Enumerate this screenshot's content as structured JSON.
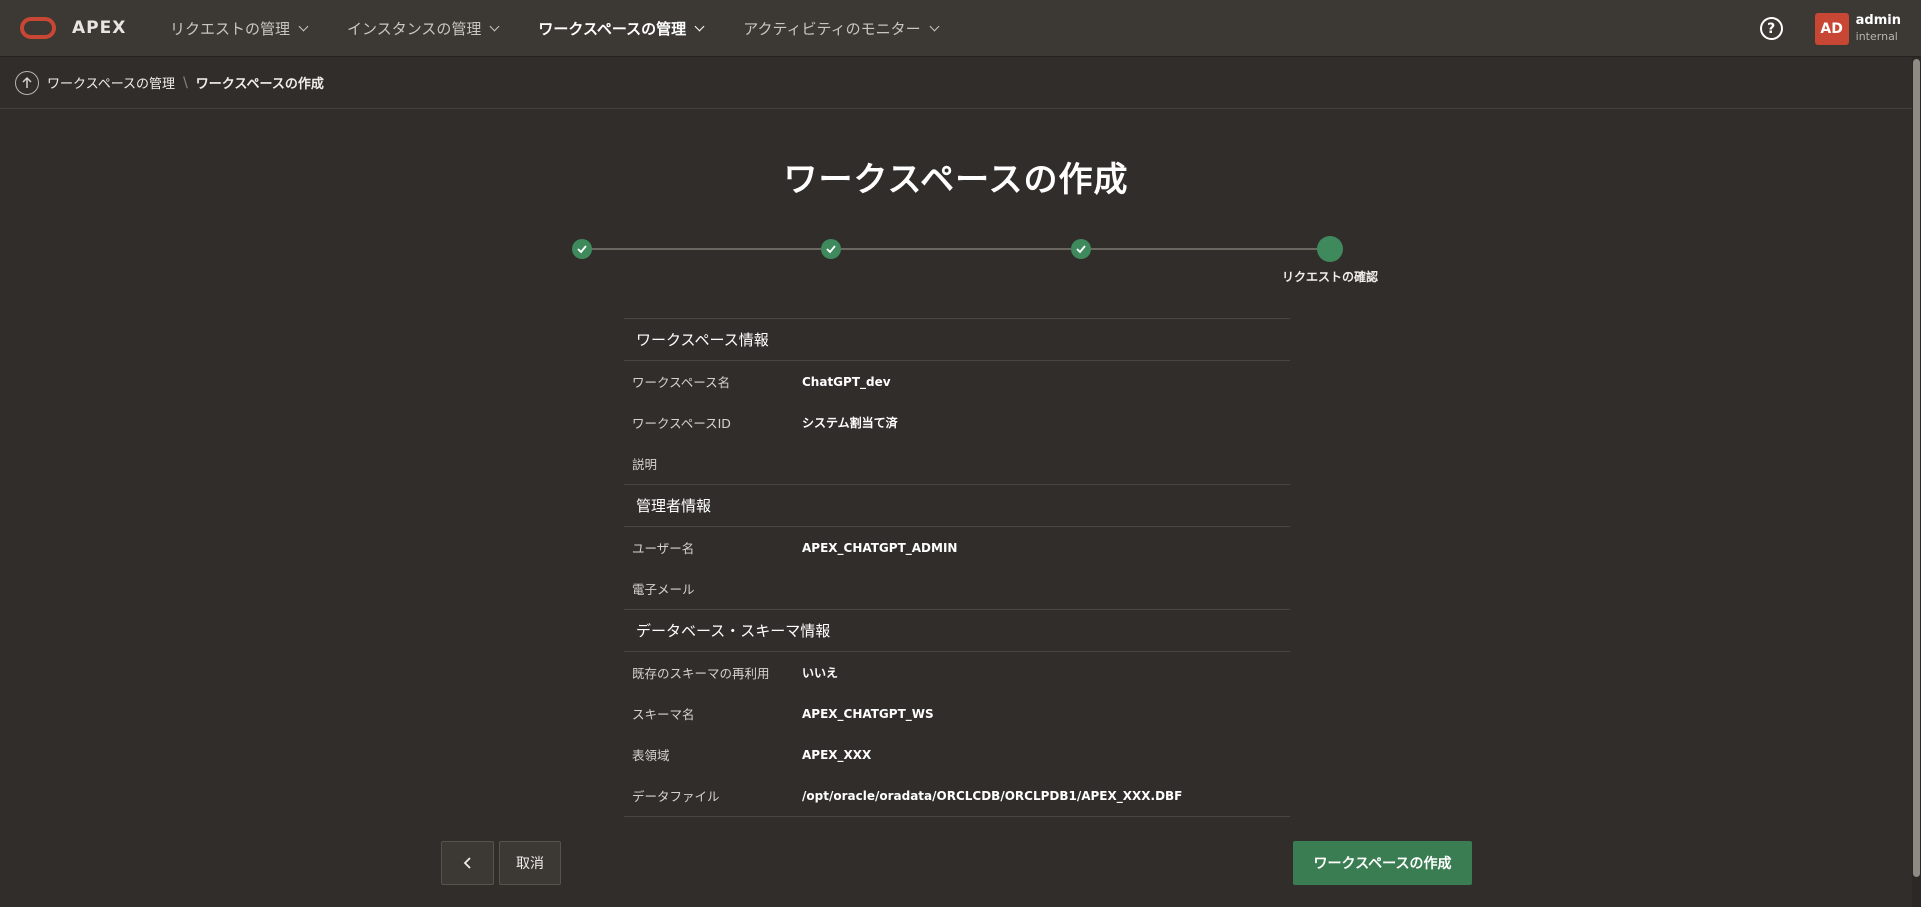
{
  "header": {
    "app_name": "APEX",
    "nav": [
      {
        "label": "リクエストの管理"
      },
      {
        "label": "インスタンスの管理"
      },
      {
        "label": "ワークスペースの管理"
      },
      {
        "label": "アクティビティのモニター"
      }
    ],
    "help_glyph": "?",
    "user": {
      "initials": "AD",
      "name": "admin",
      "workspace": "internal"
    }
  },
  "breadcrumb": {
    "parent": "ワークスペースの管理",
    "separator": "\\",
    "current": "ワークスペースの作成"
  },
  "page": {
    "title": "ワークスペースの作成"
  },
  "wizard": {
    "current_step_label": "リクエストの確認"
  },
  "summary": {
    "workspace_section": "ワークスペース情報",
    "workspace_rows": [
      {
        "label": "ワークスペース名",
        "value": "ChatGPT_dev"
      },
      {
        "label": "ワークスペースID",
        "value": "システム割当て済"
      },
      {
        "label": "説明",
        "value": ""
      }
    ],
    "admin_section": "管理者情報",
    "admin_rows": [
      {
        "label": "ユーザー名",
        "value": "APEX_CHATGPT_ADMIN"
      },
      {
        "label": "電子メール",
        "value": ""
      }
    ],
    "db_section": "データベース・スキーマ情報",
    "db_rows": [
      {
        "label": "既存のスキーマの再利用",
        "value": "いいえ"
      },
      {
        "label": "スキーマ名",
        "value": "APEX_CHATGPT_WS"
      },
      {
        "label": "表領域",
        "value": "APEX_XXX"
      },
      {
        "label": "データファイル",
        "value": "/opt/oracle/oradata/ORCLCDB/ORCLPDB1/APEX_XXX.DBF"
      }
    ]
  },
  "footer": {
    "cancel_label": "取消",
    "create_label": "ワークスペースの作成"
  },
  "colors": {
    "background": "#312d2a",
    "header": "#3c3834",
    "brand": "#c74634",
    "success": "#3a7d52"
  }
}
